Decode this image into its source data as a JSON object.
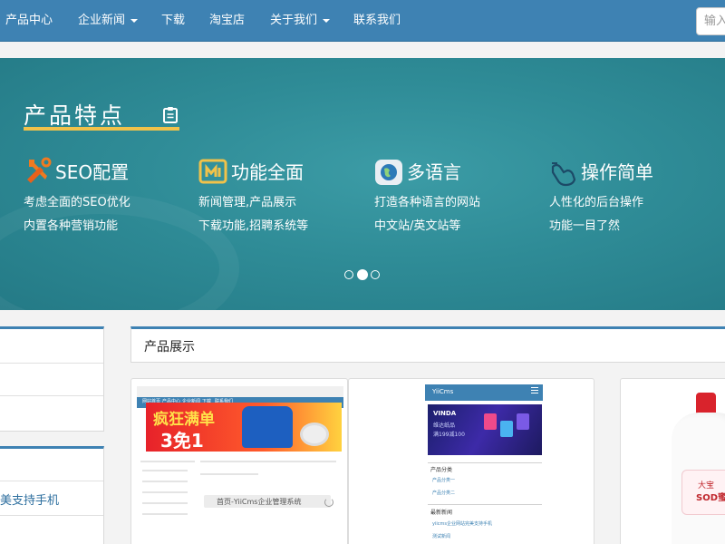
{
  "colors": {
    "nav_bg": "#3e82b3",
    "banner_bg": "#2f8c97",
    "accent_underline": "#f1c24a",
    "panel_top_border": "#3e82b3"
  },
  "nav": {
    "items": [
      {
        "label": "产品中心",
        "has_caret": false
      },
      {
        "label": "企业新闻",
        "has_caret": true
      },
      {
        "label": "下载",
        "has_caret": false
      },
      {
        "label": "淘宝店",
        "has_caret": false
      },
      {
        "label": "关于我们",
        "has_caret": true
      },
      {
        "label": "联系我们",
        "has_caret": false
      }
    ],
    "search_placeholder": "输入"
  },
  "banner": {
    "title": "产品特点",
    "title_icon": "clipboard-icon",
    "features": [
      {
        "icon": "wrench-icon",
        "title": "SEO配置",
        "lines": [
          "考虑全面的SEO优化",
          "内置各种营销功能"
        ]
      },
      {
        "icon": "function-icon",
        "title": "功能全面",
        "lines": [
          "新闻管理,产品展示",
          "下载功能,招聘系统等"
        ]
      },
      {
        "icon": "globe-icon",
        "title": "多语言",
        "lines": [
          "打造各种语言的网站",
          "中文站/英文站等"
        ]
      },
      {
        "icon": "hand-pointer-icon",
        "title": "操作简单",
        "lines": [
          "人性化的后台操作",
          "功能一目了然"
        ]
      }
    ],
    "slides": {
      "count": 3,
      "active_index": 1
    }
  },
  "sidebar": {
    "link_text": "美支持手机"
  },
  "products": {
    "section_title": "产品展示",
    "cards": [
      {
        "type": "desktop-screenshot",
        "nav_items": [
          "网站首页",
          "产品中心",
          "企业新闻",
          "下载",
          "联系我们"
        ],
        "banner_line1": "疯狂满单",
        "banner_line2": "3免1",
        "search_text": "首页-YiiCms企业管理系统"
      },
      {
        "type": "mobile-screenshot",
        "app_name": "YiiCms",
        "banner_title": "VINDA",
        "banner_sub1": "维达纸品",
        "banner_sub2": "满199减100",
        "categories_title": "产品分类",
        "category_links": [
          "产品分类一",
          "产品分类二"
        ],
        "news_title": "最新新闻",
        "news_links": [
          "yiicms企业网站完美支持手机",
          "测试新闻"
        ]
      },
      {
        "type": "product-photo",
        "label_line1": "大宝",
        "label_line2": "SOD蜜"
      }
    ]
  }
}
